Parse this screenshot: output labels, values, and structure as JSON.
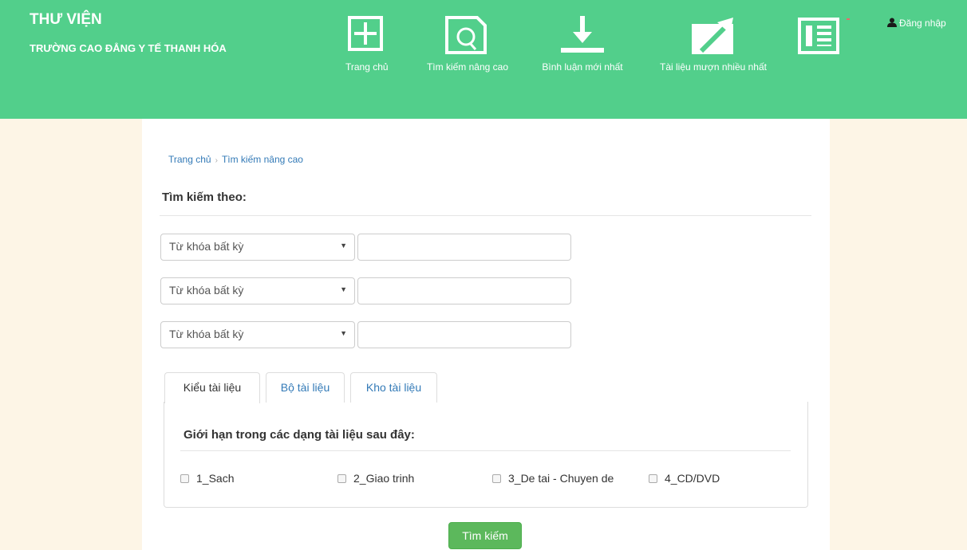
{
  "header": {
    "title": "THƯ VIỆN",
    "subtitle": "TRƯỜNG CAO ĐẲNG Y TẾ THANH HÓA",
    "nav": [
      {
        "label": "Trang chủ",
        "icon": "plus-square-icon"
      },
      {
        "label": "Tìm kiếm nâng cao",
        "icon": "search-document-icon"
      },
      {
        "label": "Bình luận mới nhất",
        "icon": "download-arrow-icon"
      },
      {
        "label": "Tài liệu mượn nhiều nhất",
        "icon": "trending-arrow-icon"
      }
    ],
    "news_icon": "newspaper-icon",
    "login": "Đăng nhập"
  },
  "colors": {
    "header": "#52cf8b",
    "page_bg": "#fdf5e6",
    "button": "#5cb85c",
    "link": "#337ab7"
  },
  "breadcrumb": {
    "home": "Trang chủ",
    "current": "Tìm kiếm nâng cao"
  },
  "search": {
    "heading": "Tìm kiếm theo:",
    "rows": [
      {
        "field": "Từ khóa bất kỳ",
        "value": ""
      },
      {
        "field": "Từ khóa bất kỳ",
        "value": ""
      },
      {
        "field": "Từ khóa bất kỳ",
        "value": ""
      }
    ]
  },
  "tabs": [
    {
      "label": "Kiểu tài liệu",
      "active": true
    },
    {
      "label": "Bộ tài liệu",
      "active": false
    },
    {
      "label": "Kho tài liệu",
      "active": false
    }
  ],
  "panel": {
    "heading": "Giới hạn trong các dạng tài liệu sau đây:",
    "options": [
      "1_Sach",
      "2_Giao trinh",
      "3_De tai - Chuyen de",
      "4_CD/DVD"
    ]
  },
  "submit_label": "Tìm kiếm"
}
